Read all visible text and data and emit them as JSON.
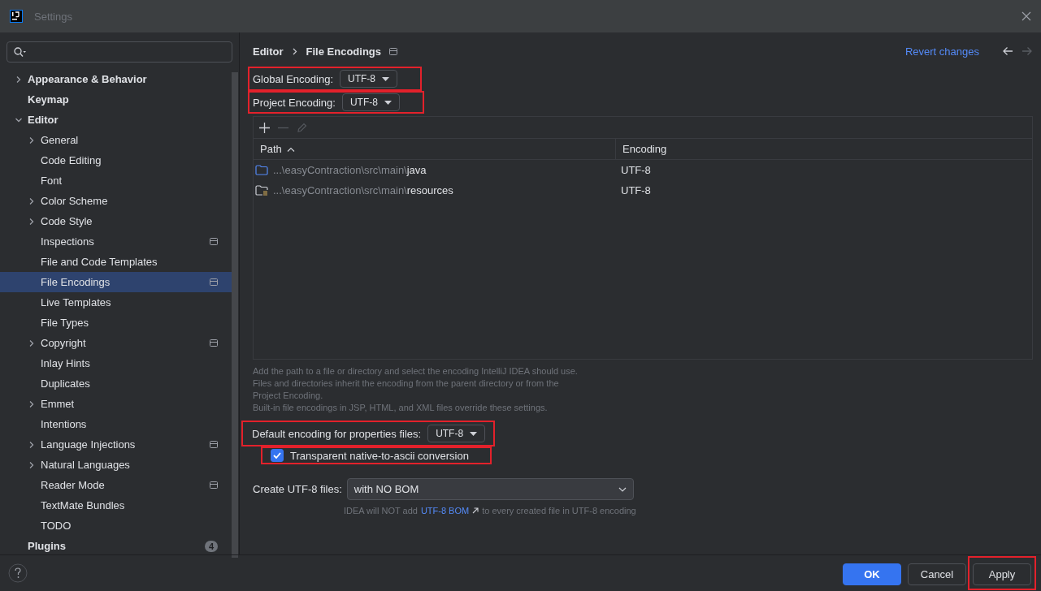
{
  "window": {
    "title": "Settings"
  },
  "sidebar": {
    "items": [
      {
        "label": "Appearance & Behavior",
        "selected": false,
        "expanded": false
      },
      {
        "label": "Keymap",
        "selected": false
      },
      {
        "label": "Editor",
        "selected": false,
        "expanded": true,
        "children": [
          {
            "label": "General",
            "selected": false,
            "expanded": false
          },
          {
            "label": "Code Editing",
            "selected": false
          },
          {
            "label": "Font",
            "selected": false
          },
          {
            "label": "Color Scheme",
            "selected": false,
            "expanded": false
          },
          {
            "label": "Code Style",
            "selected": false,
            "expanded": false
          },
          {
            "label": "Inspections",
            "selected": false,
            "project_scope": true
          },
          {
            "label": "File and Code Templates",
            "selected": false
          },
          {
            "label": "File Encodings",
            "selected": true,
            "project_scope": true
          },
          {
            "label": "Live Templates",
            "selected": false
          },
          {
            "label": "File Types",
            "selected": false
          },
          {
            "label": "Copyright",
            "selected": false,
            "expanded": false,
            "project_scope": true
          },
          {
            "label": "Inlay Hints",
            "selected": false
          },
          {
            "label": "Duplicates",
            "selected": false
          },
          {
            "label": "Emmet",
            "selected": false,
            "expanded": false
          },
          {
            "label": "Intentions",
            "selected": false
          },
          {
            "label": "Language Injections",
            "selected": false,
            "expanded": false,
            "project_scope": true
          },
          {
            "label": "Natural Languages",
            "selected": false,
            "expanded": false
          },
          {
            "label": "Reader Mode",
            "selected": false,
            "project_scope": true
          },
          {
            "label": "TextMate Bundles",
            "selected": false
          },
          {
            "label": "TODO",
            "selected": false
          }
        ]
      },
      {
        "label": "Plugins",
        "selected": false,
        "badge": "4"
      }
    ]
  },
  "breadcrumb": [
    "Editor",
    "File Encodings"
  ],
  "revert_link": "Revert changes",
  "global_encoding": {
    "label": "Global Encoding:",
    "value": "UTF-8",
    "highlighted": true
  },
  "project_encoding": {
    "label": "Project Encoding:",
    "value": "UTF-8",
    "highlighted": true
  },
  "table": {
    "columns": [
      "Path",
      "Encoding"
    ],
    "rows": [
      {
        "kind": "folder",
        "path_prefix": "...\\easyContraction\\src\\main\\",
        "name": "java",
        "encoding": "UTF-8"
      },
      {
        "kind": "resources",
        "path_prefix": "...\\easyContraction\\src\\main\\",
        "name": "resources",
        "encoding": "UTF-8"
      }
    ]
  },
  "help_text": [
    "Add the path to a file or directory and select the encoding IntelliJ IDEA should use.",
    "Files and directories inherit the encoding from the parent directory or from the Project Encoding.",
    "Built-in file encodings in JSP, HTML, and XML files override these settings."
  ],
  "properties_encoding": {
    "label": "Default encoding for properties files:",
    "value": "UTF-8",
    "highlighted": true
  },
  "native_to_ascii": {
    "label": "Transparent native-to-ascii conversion",
    "checked": true,
    "highlighted": true
  },
  "create_utf8": {
    "label": "Create UTF-8 files:",
    "value": "with NO BOM"
  },
  "bom_hint": {
    "before": "IDEA will NOT add",
    "link": "UTF-8 BOM",
    "after": "to every created file in UTF-8 encoding"
  },
  "buttons": [
    {
      "label": "OK",
      "kind": "primary",
      "highlighted": false
    },
    {
      "label": "Cancel",
      "kind": "normal",
      "highlighted": false
    },
    {
      "label": "Apply",
      "kind": "normal",
      "highlighted": true
    }
  ]
}
